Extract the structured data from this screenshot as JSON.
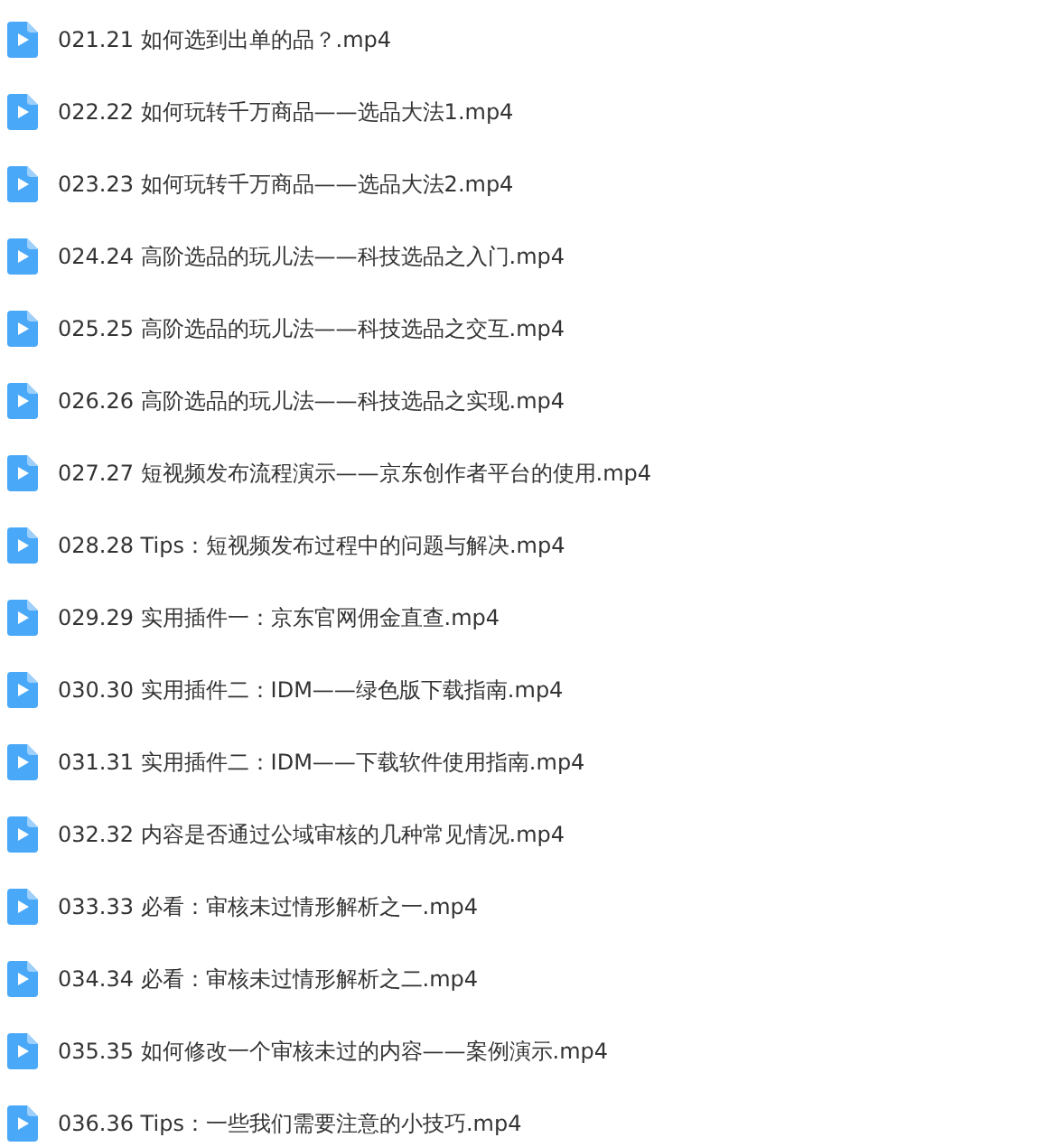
{
  "files": [
    {
      "name": "021.21 如何选到出单的品？.mp4"
    },
    {
      "name": "022.22 如何玩转千万商品——选品大法1.mp4"
    },
    {
      "name": "023.23 如何玩转千万商品——选品大法2.mp4"
    },
    {
      "name": "024.24 高阶选品的玩儿法——科技选品之入门.mp4"
    },
    {
      "name": "025.25 高阶选品的玩儿法——科技选品之交互.mp4"
    },
    {
      "name": "026.26 高阶选品的玩儿法——科技选品之实现.mp4"
    },
    {
      "name": "027.27 短视频发布流程演示——京东创作者平台的使用.mp4"
    },
    {
      "name": "028.28 Tips：短视频发布过程中的问题与解决.mp4"
    },
    {
      "name": "029.29 实用插件一：京东官网佣金直查.mp4"
    },
    {
      "name": "030.30 实用插件二：IDM——绿色版下载指南.mp4"
    },
    {
      "name": "031.31 实用插件二：IDM——下载软件使用指南.mp4"
    },
    {
      "name": "032.32 内容是否通过公域审核的几种常见情况.mp4"
    },
    {
      "name": "033.33 必看：审核未过情形解析之一.mp4"
    },
    {
      "name": "034.34 必看：审核未过情形解析之二.mp4"
    },
    {
      "name": "035.35 如何修改一个审核未过的内容——案例演示.mp4"
    },
    {
      "name": "036.36 Tips：一些我们需要注意的小技巧.mp4"
    }
  ]
}
